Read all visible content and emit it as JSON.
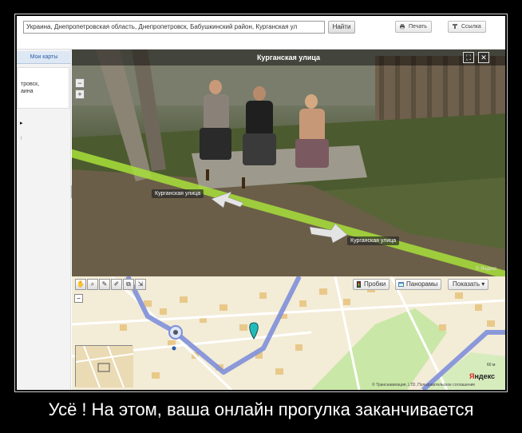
{
  "search": {
    "address_value": "Украина, Днепропетровская область, Днепропетровск, Бабушкинский район, Курганская ул",
    "find_label": "Найти"
  },
  "toolbar": {
    "print_label": "Печать",
    "link_label": "Ссылка"
  },
  "sidebar": {
    "my_maps_tab": "Мои карты",
    "card_text_line1": "тровск,",
    "card_text_line2": "аина",
    "marker1": "▸",
    "marker2": "↑"
  },
  "panorama": {
    "title": "Курганская улица",
    "street_label_1": "Курганская улица",
    "street_label_2": "Курганская улица",
    "copyright": "© Яндекс",
    "zoom_minus": "−",
    "zoom_plus": "+"
  },
  "map": {
    "traffic_label": "Пробки",
    "panoramas_label": "Панорамы",
    "show_label": "Показать ▾",
    "copyright": "© Транснавигация, LTD, Пользовательское соглашение",
    "yandex_y": "Я",
    "yandex_rest": "ндекс",
    "scale": "60 м",
    "zoom_minus": "−"
  },
  "caption": "Усё ! На этом, ваша онлайн прогулка заканчивается",
  "colors": {
    "route": "#7f8fd9",
    "grass_path": "#a8e03a",
    "map_bg": "#f3ecd7",
    "park": "#c9e7a6"
  }
}
